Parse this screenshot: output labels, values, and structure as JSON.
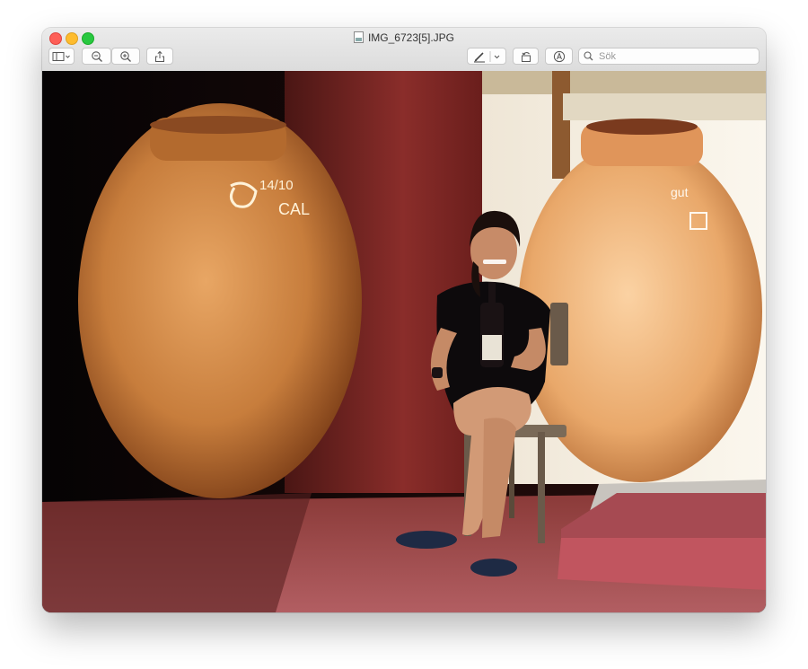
{
  "window": {
    "title": "IMG_6723[5].JPG"
  },
  "toolbar": {
    "sidebar_toggle_icon": "sidebar-icon",
    "zoom_out_icon": "magnifier-minus-icon",
    "zoom_in_icon": "magnifier-plus-icon",
    "share_icon": "share-icon",
    "markup_icon": "pen-icon",
    "rotate_icon": "rotate-left-icon",
    "annotate_icon": "markup-circle-icon",
    "search_placeholder": "Sök"
  },
  "image": {
    "jar_left_scratch_1": "14/10",
    "jar_left_scratch_2": "CAL",
    "jar_right_scratch": "gut"
  },
  "colors": {
    "close": "#fe5f57",
    "minimize": "#febc2e",
    "zoom": "#28c840"
  }
}
